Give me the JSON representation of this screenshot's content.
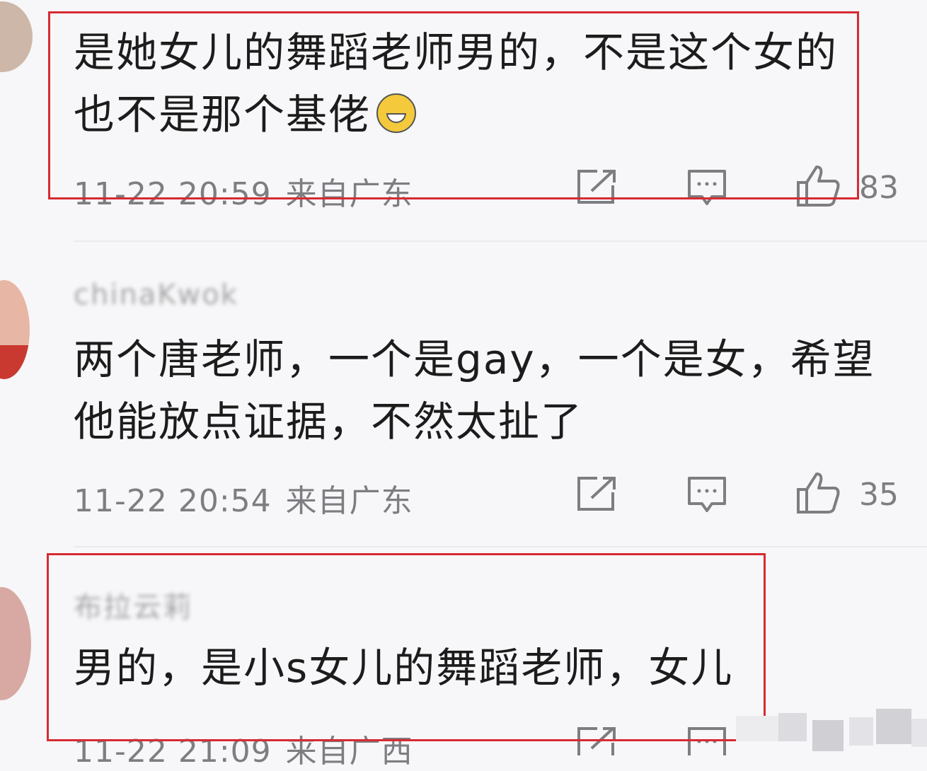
{
  "comments": [
    {
      "text_line1": "是她女儿的舞蹈老师男的，不是这个女的",
      "text_line2": "也不是那个基佬",
      "emoji": "laughing-tears-emoji",
      "time": "11-22 20:59",
      "region": "来自广东",
      "likes": "83",
      "highlighted": true
    },
    {
      "username": "chinaKwok",
      "text_line1": "两个唐老师，一个是gay，一个是女，希望",
      "text_line2": "他能放点证据，不然太扯了",
      "time": "11-22 20:54",
      "region": "来自广东",
      "likes": "35",
      "highlighted": false
    },
    {
      "username": "布拉云莉",
      "text_line1": "男的，是小s女儿的舞蹈老师，女儿",
      "time": "11-22 21:09",
      "region": "来自广西",
      "highlighted": true
    }
  ],
  "icons": [
    "share-icon",
    "comment-icon",
    "like-icon"
  ],
  "colors": {
    "highlight_border": "#d62b32",
    "meta_text": "#7d7d82",
    "body_text": "#1c1c1c"
  }
}
